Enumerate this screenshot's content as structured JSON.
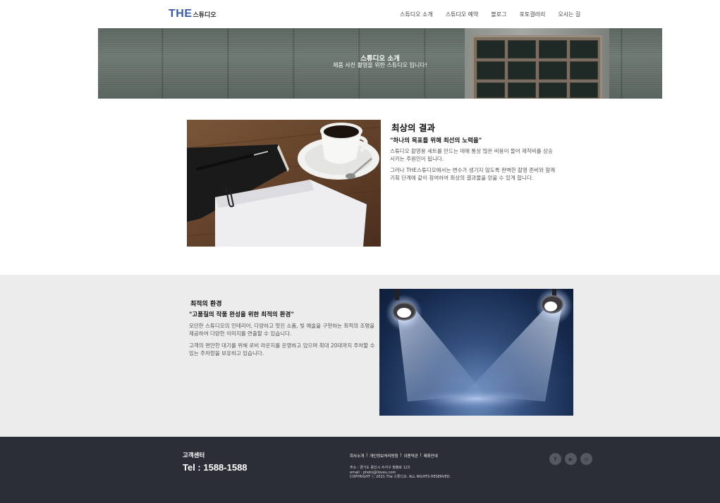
{
  "header": {
    "logo_the": "THE",
    "logo_studio": "스튜디오",
    "nav": [
      "스튜디오 소개",
      "스튜디오 예약",
      "블로그",
      "포토갤러리",
      "오시는 길"
    ]
  },
  "banner": {
    "title": "스튜디오 소개",
    "subtitle": "제품 사진 촬영을 위한 스튜디오 입니다!"
  },
  "section1": {
    "title": "최상의 결과",
    "quote": "\"하나의 목표를 위해 최선의 노력을\"",
    "p1": "스튜디오 촬영용 세트를 만드는 데에 통상 많은 비용이 들어 제작비를 상승시키는 주원인이 됩니다.",
    "p2": "그러나 THE스튜디오에서는 변수가 생기지 않도록 완벽한 촬영 준비와 함께 기획 단계에 같이 참여하여 최상의 결과물을 얻을 수 있게 합니다."
  },
  "section2": {
    "title": "최적의 환경",
    "quote": "\"고품질의 작품 완성을 위한 최적의 환경\"",
    "p1": "모던한 스튜디오의 인테리어, 다양하고 멋진 소품, 빛 예술을 구현하는 최적의 조명을 제공하여 다양한 이미지를 연출할 수 있습니다.",
    "p2": "고객의 편안한 대기를 위해 로비 라운지를 운영하고 있으며 최대 20대까지 주차할 수 있는 주차장을 보유하고 있습니다."
  },
  "footer": {
    "cs_label": "고객센터",
    "tel": "Tel : 1588-1588",
    "links": [
      "회사소개",
      "개인정보처리방침",
      "이용약관",
      "제휴안내"
    ],
    "address": "주소 : 경기도 용인시 수지구 정평로 123",
    "email": "email : photo@iloveu.com",
    "copyright": "COPYRIGHT ⓒ 2021 The 스튜디오. ALL RIGHTS RESERVED.",
    "social": [
      "facebook-icon",
      "youtube-icon",
      "instagram-icon"
    ]
  },
  "colors": {
    "logo_accent": "#3a5aa8",
    "band_bg": "#ececec",
    "footer_bg": "#2b2e36"
  }
}
